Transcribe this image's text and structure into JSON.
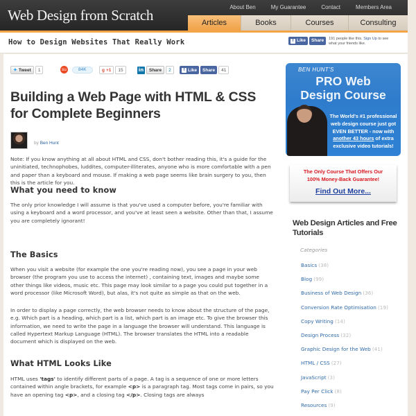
{
  "header": {
    "logo": "Web Design from Scratch",
    "top_links": [
      "About Ben",
      "My Guarantee",
      "Contact",
      "Members Area"
    ],
    "main_nav": [
      {
        "label": "Articles",
        "active": true
      },
      {
        "label": "Books",
        "active": false
      },
      {
        "label": "Courses",
        "active": false
      },
      {
        "label": "Consulting",
        "active": false
      }
    ],
    "accent_color": "#f2a446"
  },
  "tagbar": {
    "tagline": "How to Design Websites That Really Work",
    "fb_like": "Like",
    "fb_share": "Share",
    "fb_count_text": "191 people like this.",
    "fb_signup": "Sign Up",
    "fb_suffix": "to see what your friends like."
  },
  "social": {
    "tweet_label": "Tweet",
    "tweet_count": "1",
    "stumble_count": "84K",
    "gplus_label": "+1",
    "gplus_count": "15",
    "linkedin_label": "Share",
    "linkedin_count": "2",
    "fb_like": "Like",
    "fb_share": "Share",
    "fb_count": "41"
  },
  "article": {
    "title": "Building a Web Page with HTML & CSS for Complete Beginners",
    "by": "by",
    "author": "Ben Hunt",
    "intro": "Note: If you know anything at all about HTML and CSS, don't bother reading this, it's a guide for the uninitiated, technophobes, luddites, computer-illiterates, anyone who is more comfortable with a pen and paper than a keyboard and mouse. If making a web page seems like brain surgery to you, then this is the article for you.",
    "sections": [
      {
        "heading": "What you need to know",
        "paragraphs": [
          "The only prior knowledge I will assume is that you've used a computer before, you're familiar with using a keyboard and a word processor, and you've at least seen a website. Other than that, I assume you are completely ignorant!"
        ]
      },
      {
        "heading": "The Basics",
        "paragraphs": [
          "When you visit a website (for example the one you're reading now), you see a page in your web browser (the program you use to access the internet) , containing text, images and maybe some other things like videos, music etc. This page may look similar to a page you could put together in a word processor (like Microsoft Word), but alas, it's not quite as simple as that on the web.",
          "In order to display a page correctly, the web browser needs to know about the structure of the page, e.g. Which part is a heading, which part is a list, which part is an image etc. To give the browser this information, we need to write the page in a language the browser will understand. This language is called Hypertext Markup Language (HTML). The browser translates the HTML into a readable document which is displayed on the web."
        ]
      },
      {
        "heading": "What HTML Looks Like",
        "p_start": "HTML uses ",
        "p_tags": "'tags'",
        "p_mid": " to identify different parts of a page. A tag is a sequence of one or more letters contained within angle brackets, for example ",
        "p_code1": "<p>",
        "p_mid2": " is a paragraph tag. Most tags come in pairs, so you have an opening tag ",
        "p_code2": "<p>",
        "p_mid3": ", and a closing tag ",
        "p_code3": "</p>",
        "p_end": ". Closing tags are always"
      }
    ]
  },
  "promo": {
    "small": "BEN HUNT'S",
    "line1": "PRO Web",
    "line2": "Design Course",
    "blurb_1": "The World's #1 professional web design course just got EVEN BETTER - now with ",
    "blurb_u": "another 43 hours",
    "blurb_2": " of extra exclusive video tutorials!",
    "guarantee_1": "The Only Course That Offers Our",
    "guarantee_2": "100% Money-Back Guarantee!",
    "cta": "Find Out More..."
  },
  "sidebar": {
    "heading": "Web Design Articles and Free Tutorials",
    "categories_label": "Categories",
    "categories": [
      {
        "name": "Basics",
        "count": "(38)"
      },
      {
        "name": "Blog",
        "count": "(99)"
      },
      {
        "name": "Business of Web Design",
        "count": "(36)"
      },
      {
        "name": "Conversion Rate Optimisation",
        "count": "(19)"
      },
      {
        "name": "Copy Writing",
        "count": "(14)"
      },
      {
        "name": "Design Process",
        "count": "(32)"
      },
      {
        "name": "Graphic Design for the Web",
        "count": "(41)"
      },
      {
        "name": "HTML / CSS",
        "count": "(27)"
      },
      {
        "name": "JavaScript",
        "count": "(3)"
      },
      {
        "name": "Pay Per Click",
        "count": "(8)"
      },
      {
        "name": "Resources",
        "count": "(9)"
      }
    ]
  }
}
